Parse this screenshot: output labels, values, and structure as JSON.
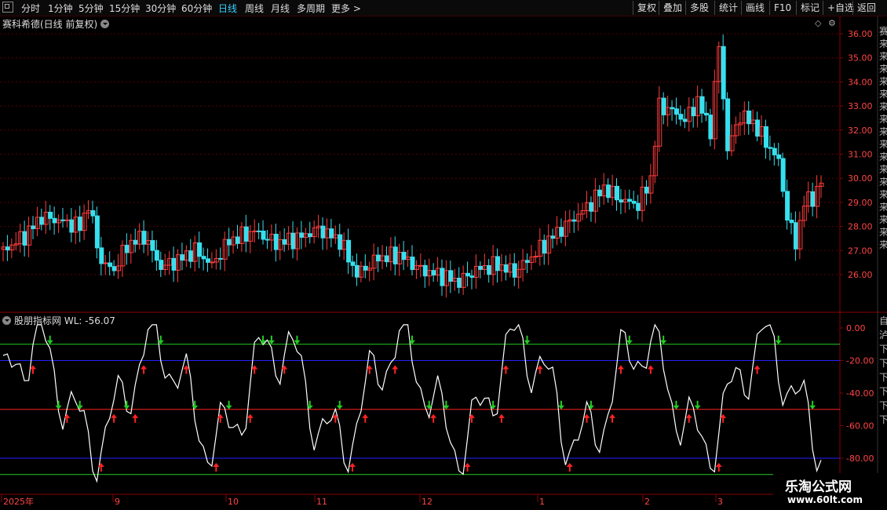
{
  "toolbar": {
    "timeframes": [
      "分时",
      "1分钟",
      "5分钟",
      "15分钟",
      "30分钟",
      "60分钟",
      "日线",
      "周线",
      "月线",
      "多周期",
      "更多 >"
    ],
    "active_timeframe": "日线",
    "right_buttons": [
      "复权",
      "叠加",
      "多股",
      "统计",
      "画线",
      "F10",
      "标记",
      "+自选",
      "返回"
    ]
  },
  "main_chart": {
    "title": "赛科希德(日线 前复权)",
    "price_ticks": [
      "36.00",
      "35.00",
      "34.00",
      "33.00",
      "32.00",
      "31.00",
      "30.00",
      "29.00",
      "28.00",
      "27.00",
      "26.00"
    ],
    "side_text": "赛来来来来来来来来来来来来来来来来来",
    "colors": {
      "up": "#ff3c3c",
      "down": "#36e0ee",
      "grid": "#5a0000",
      "axis": "#8b0000"
    }
  },
  "indicator": {
    "name": "股朋指标网",
    "value_label": "WL: -56.07",
    "value_ticks": [
      "0.00",
      "-20.00",
      "-40.00",
      "-60.00",
      "-80.00"
    ],
    "side_text": "自泸下下下下下下",
    "levels": [
      {
        "value": -10,
        "color": "#22cc22"
      },
      {
        "value": -20,
        "color": "#2222ff"
      },
      {
        "value": -50,
        "color": "#ff2222"
      },
      {
        "value": -80,
        "color": "#2222ff"
      },
      {
        "value": -90,
        "color": "#22cc22"
      }
    ]
  },
  "date_axis": {
    "labels": [
      "2025年",
      "9",
      "10",
      "11",
      "12",
      "1",
      "2",
      "3"
    ]
  },
  "watermark": {
    "line1": "乐淘公式网",
    "line2": "www.60lt.com"
  }
}
